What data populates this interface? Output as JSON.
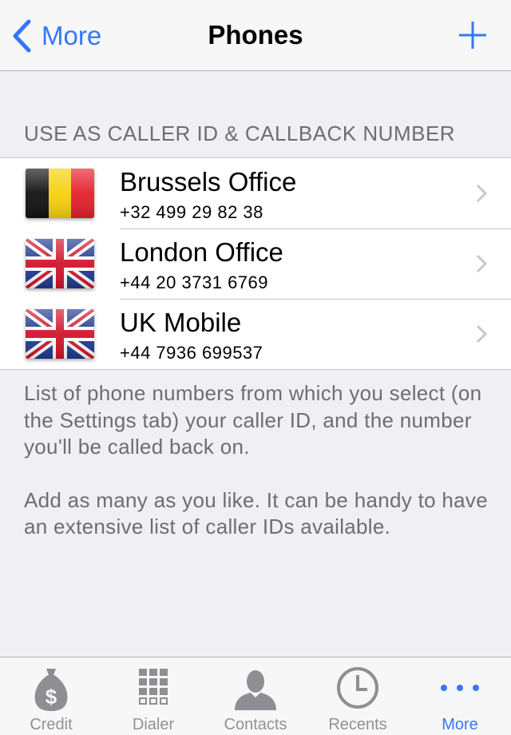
{
  "navbar": {
    "back_label": "More",
    "title": "Phones"
  },
  "section": {
    "header": "USE AS CALLER ID & CALLBACK NUMBER"
  },
  "phones": [
    {
      "name": "Brussels Office",
      "number": "+32 499 29 82 38",
      "flag": "belgium-flag"
    },
    {
      "name": "London Office",
      "number": "+44 20 3731 6769",
      "flag": "uk-flag"
    },
    {
      "name": "UK Mobile",
      "number": "+44 7936 699537",
      "flag": "uk-flag"
    }
  ],
  "footer": {
    "paragraph1": "List of phone numbers from which you select (on the Settings tab) your caller ID, and the number you'll be called back on.",
    "paragraph2": "Add as many as you like. It can be handy to have an extensive list of caller IDs available."
  },
  "tabs": [
    {
      "label": "Credit",
      "icon": "money-bag-icon",
      "active": false
    },
    {
      "label": "Dialer",
      "icon": "keypad-icon",
      "active": false
    },
    {
      "label": "Contacts",
      "icon": "person-icon",
      "active": false
    },
    {
      "label": "Recents",
      "icon": "clock-icon",
      "active": false
    },
    {
      "label": "More",
      "icon": "more-dots-icon",
      "active": true
    }
  ],
  "colors": {
    "accent": "#3478f6",
    "background": "#efeff4",
    "secondary_text": "#6d6d72",
    "inactive_tab": "#929292"
  }
}
